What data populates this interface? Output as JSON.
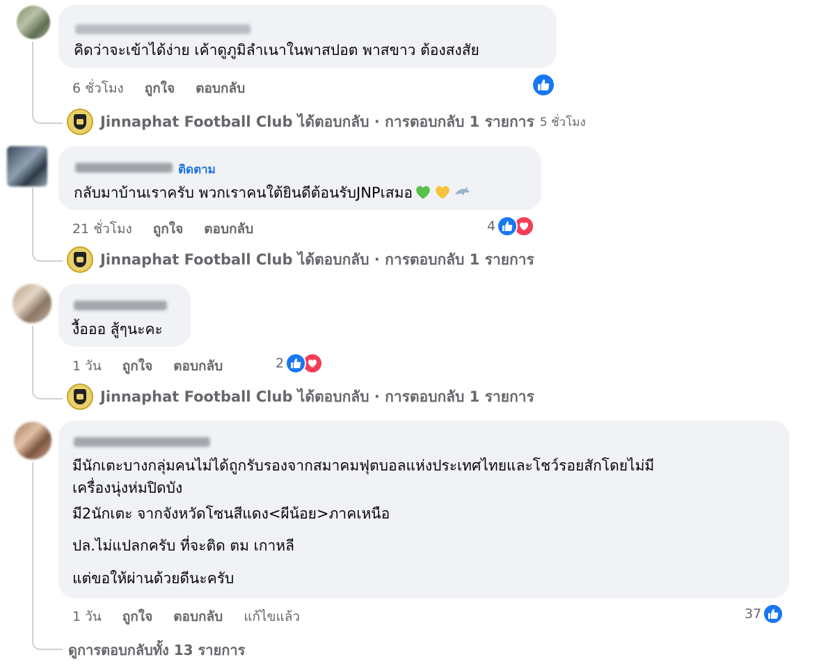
{
  "comments": [
    {
      "text_lines": [
        "คิดว่าจะเข้าได้ง่าย เค้าดูภูมิลำเนาในพาสปอต พาสขาว ต้องสงสัย"
      ],
      "time": "6 ชั่วโมง",
      "like_label": "ถูกใจ",
      "reply_label": "ตอบกลับ",
      "reaction_count": "",
      "reply": {
        "text": "Jinnaphat Football Club ได้ตอบกลับ · การตอบกลับ 1 รายการ",
        "time": "5 ชั่วโมง"
      }
    },
    {
      "follow": "ติดตาม",
      "text_lines": [
        "กลับมาบ้านเราครับ พวกเราคนใต้ยินดีต้อนรับJNPเสมอ"
      ],
      "time": "21 ชั่วโมง",
      "like_label": "ถูกใจ",
      "reply_label": "ตอบกลับ",
      "reaction_count": "4",
      "reply": {
        "text": "Jinnaphat Football Club ได้ตอบกลับ · การตอบกลับ 1 รายการ",
        "time": ""
      }
    },
    {
      "text_lines": [
        "งื้อออ สู้ๆนะคะ"
      ],
      "time": "1 วัน",
      "like_label": "ถูกใจ",
      "reply_label": "ตอบกลับ",
      "reaction_count": "2",
      "reply": {
        "text": "Jinnaphat Football Club ได้ตอบกลับ · การตอบกลับ 1 รายการ",
        "time": ""
      }
    },
    {
      "text_lines": [
        "มีนักเตะบางกลุ่มคนไม่ได้ถูกรับรองจากสมาคมฟุตบอลแห่งประเทศไทยและโชว์รอยสักโดยไม่มี",
        "เครื่องนุ่งห่มปิดบัง",
        "มี2นักเตะ จากจังหวัดโซนสีแดง<ผีน้อย>ภาคเหนือ",
        "ปล.ไม่แปลกครับ ที่จะติด ตม เกาหลี",
        "แต่ขอให้ผ่านด้วยดีนะครับ"
      ],
      "time": "1 วัน",
      "like_label": "ถูกใจ",
      "reply_label": "ตอบกลับ",
      "edited_label": "แก้ไขแล้ว",
      "reaction_count": "37",
      "view_all": "ดูการตอบกลับทั้ง 13 รายการ"
    }
  ],
  "icons": {
    "like": "thumbs-up-icon",
    "love": "heart-icon",
    "emoji": [
      "green-heart",
      "yellow-heart",
      "dolphin"
    ]
  },
  "colors": {
    "bubble": "#f0f2f5",
    "like_blue": "#1877f2",
    "love_red": "#f33e58",
    "meta_gray": "#65676b"
  }
}
